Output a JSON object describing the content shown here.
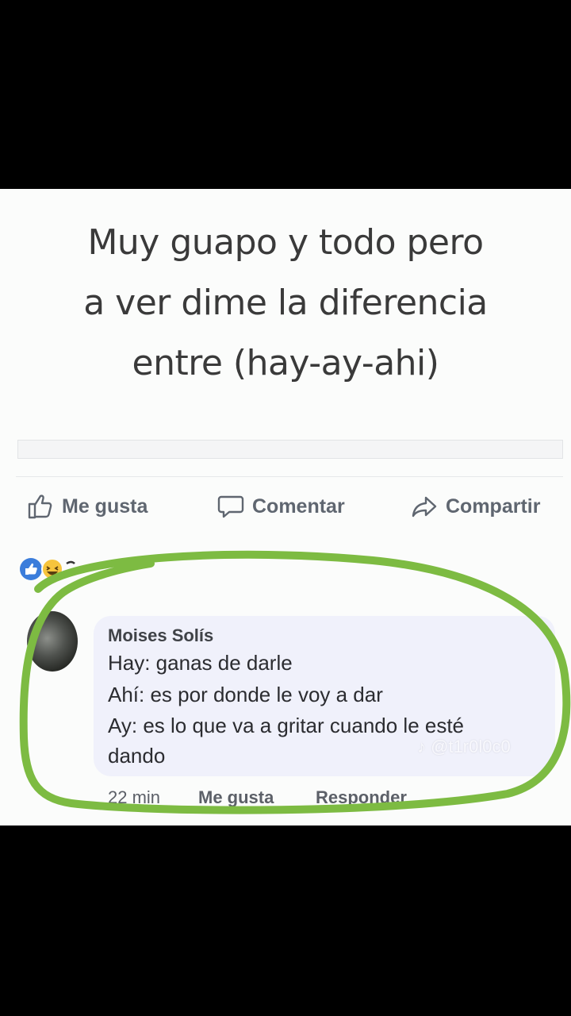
{
  "post": {
    "text_lines": [
      "Muy guapo y todo pero",
      "a ver dime la diferencia",
      "entre (hay-ay-ahi)"
    ]
  },
  "actions": {
    "like": "Me gusta",
    "comment": "Comentar",
    "share": "Compartir"
  },
  "comment": {
    "author": "Moises Solís",
    "lines": [
      "Hay: ganas de darle",
      "Ahí: es por donde le voy a dar",
      "Ay: es lo que va a gritar cuando le esté",
      "dando"
    ],
    "time": "22 min",
    "like": "Me gusta",
    "reply": "Responder"
  },
  "watermark": "@t1r0l0c0",
  "colors": {
    "highlight": "#7dbb42",
    "reaction_like": "#3b7ddb",
    "reaction_haha": "#f6c43d"
  },
  "icons": [
    "thumbs-up-icon",
    "speech-bubble-icon",
    "share-arrow-icon",
    "like-reaction-icon",
    "haha-reaction-icon",
    "tiktok-icon"
  ]
}
